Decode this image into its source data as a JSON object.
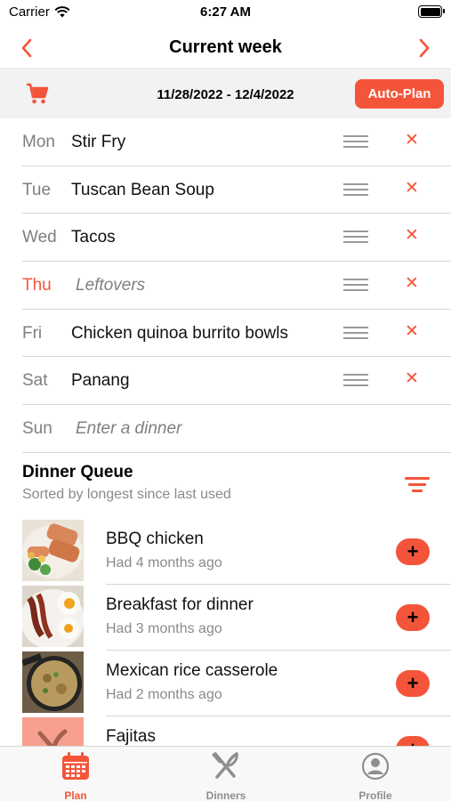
{
  "status_bar": {
    "carrier": "Carrier",
    "time": "6:27 AM"
  },
  "nav": {
    "title": "Current week",
    "prev_icon": "chevron-left-icon",
    "next_icon": "chevron-right-icon"
  },
  "week": {
    "range": "11/28/2022 - 12/4/2022",
    "auto_plan_label": "Auto-Plan",
    "cart_icon": "cart-icon"
  },
  "days": [
    {
      "day": "Mon",
      "dinner": "Stir Fry",
      "placeholder": false,
      "today": false,
      "removable": true
    },
    {
      "day": "Tue",
      "dinner": "Tuscan Bean Soup",
      "placeholder": false,
      "today": false,
      "removable": true
    },
    {
      "day": "Wed",
      "dinner": "Tacos",
      "placeholder": false,
      "today": false,
      "removable": true
    },
    {
      "day": "Thu",
      "dinner": "Leftovers",
      "placeholder": true,
      "today": true,
      "removable": true
    },
    {
      "day": "Fri",
      "dinner": "Chicken quinoa burrito bowls",
      "placeholder": false,
      "today": false,
      "removable": true
    },
    {
      "day": "Sat",
      "dinner": "Panang",
      "placeholder": false,
      "today": false,
      "removable": true
    },
    {
      "day": "Sun",
      "dinner": "Enter a dinner",
      "placeholder": true,
      "today": false,
      "removable": false
    }
  ],
  "remove_symbol": "✕",
  "queue": {
    "title": "Dinner Queue",
    "subtitle": "Sorted by longest since last used",
    "add_symbol": "+",
    "items": [
      {
        "name": "BBQ chicken",
        "last_used": "Had 4 months ago",
        "photo": "bbq-chicken-photo"
      },
      {
        "name": "Breakfast for dinner",
        "last_used": "Had 3 months ago",
        "photo": "breakfast-photo"
      },
      {
        "name": "Mexican rice casserole",
        "last_used": "Had 2 months ago",
        "photo": "casserole-photo"
      },
      {
        "name": "Fajitas",
        "last_used": "",
        "photo": "fork-knife-placeholder"
      }
    ]
  },
  "tabs": [
    {
      "label": "Plan",
      "icon": "calendar-icon",
      "active": true
    },
    {
      "label": "Dinners",
      "icon": "fork-knife-icon",
      "active": false
    },
    {
      "label": "Profile",
      "icon": "profile-icon",
      "active": false
    }
  ],
  "colors": {
    "accent": "#f4553a",
    "muted_text": "#8a8a8a",
    "divider": "#d6d6d6",
    "week_bar_bg": "#f2f2f2"
  }
}
